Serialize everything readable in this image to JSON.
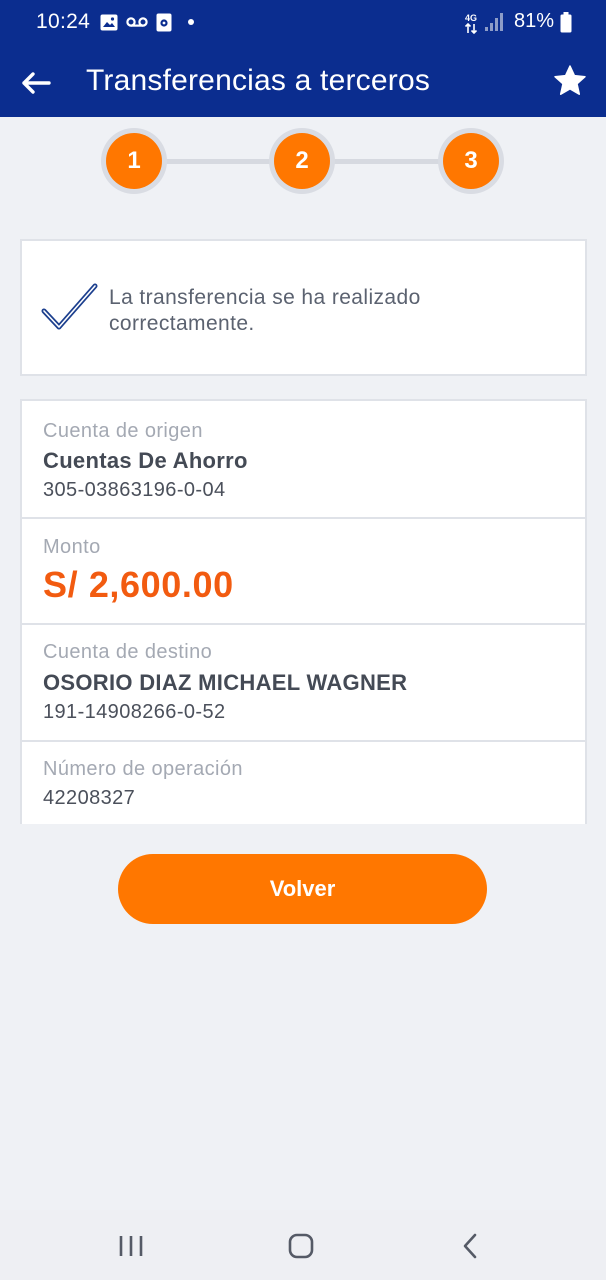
{
  "status_bar": {
    "time": "10:24",
    "network": "4G",
    "battery": "81%",
    "icons": [
      "image-icon",
      "voicemail-icon",
      "media-icon",
      "notification-dot",
      "data-arrows-icon",
      "signal-icon",
      "battery-icon"
    ]
  },
  "app_bar": {
    "title": "Transferencias a terceros",
    "back_icon": "arrow-left-icon",
    "favorite_icon": "star-icon"
  },
  "stepper": {
    "steps": [
      "1",
      "2",
      "3"
    ],
    "active_step": 3
  },
  "success": {
    "message": "La transferencia se ha realizado correctamente.",
    "icon": "checkmark-icon"
  },
  "details": {
    "origin_label": "Cuenta de origen",
    "origin_type": "Cuentas De Ahorro",
    "origin_number": "305-03863196-0-04",
    "amount_label": "Monto",
    "amount_value": "S/ 2,600.00",
    "destination_label": "Cuenta de destino",
    "destination_name": "OSORIO DIAZ MICHAEL WAGNER",
    "destination_number": "191-14908266-0-52",
    "operation_label": "Número de operación",
    "operation_number": "42208327"
  },
  "actions": {
    "back_label": "Volver"
  },
  "nav_bar": {
    "icons": [
      "recent-apps-icon",
      "home-icon",
      "back-icon"
    ]
  },
  "colors": {
    "header": "#0b2d8f",
    "accent": "#ff7700",
    "amount": "#f25b10",
    "background": "#eff1f5",
    "check": "#1c3f8e"
  }
}
